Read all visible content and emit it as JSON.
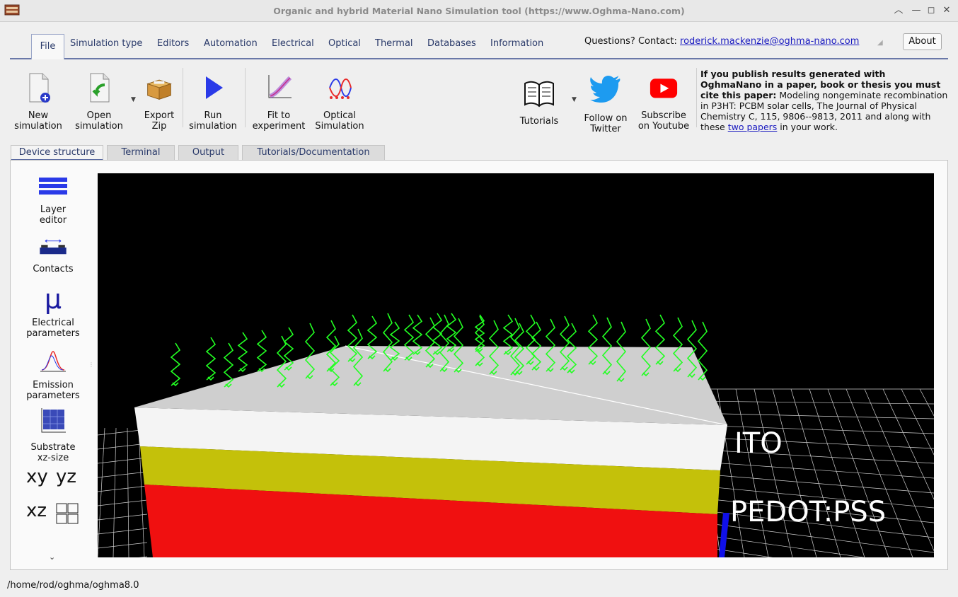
{
  "window": {
    "title": "Organic and hybrid Material Nano Simulation tool (https://www.Oghma-Nano.com)"
  },
  "menu": {
    "tabs": [
      {
        "label": "File"
      },
      {
        "label": "Simulation type"
      },
      {
        "label": "Editors"
      },
      {
        "label": "Automation"
      },
      {
        "label": "Electrical"
      },
      {
        "label": "Optical"
      },
      {
        "label": "Thermal"
      },
      {
        "label": "Databases"
      },
      {
        "label": "Information"
      }
    ]
  },
  "contact": {
    "prefix": "Questions? Contact: ",
    "email": "roderick.mackenzie@oghma-nano.com"
  },
  "about_label": "About",
  "toolbar": {
    "new_line1": "New",
    "new_line2": "simulation",
    "open_line1": "Open",
    "open_line2": "simulation",
    "export_line1": "Export",
    "export_line2": "Zip",
    "run_line1": "Run",
    "run_line2": "simulation",
    "fit_line1": "Fit to",
    "fit_line2": "experiment",
    "optical_line1": "Optical",
    "optical_line2": "Simulation",
    "tutorials": "Tutorials",
    "twitter_line1": "Follow on",
    "twitter_line2": "Twitter",
    "youtube_line1": "Subscribe",
    "youtube_line2": "on Youtube"
  },
  "cite": {
    "bold": "If you publish results generated with OghmaNano in a paper, book or thesis you must cite this paper:",
    "text": " Modeling nongeminate recombination in P3HT: PCBM solar cells, The Journal of Physical Chemistry C, 115, 9806--9813, 2011 and along with these ",
    "link": "two papers",
    "tail": " in your work."
  },
  "subtabs": [
    {
      "label": "Device structure"
    },
    {
      "label": "Terminal"
    },
    {
      "label": "Output"
    },
    {
      "label": "Tutorials/Documentation"
    }
  ],
  "sidebar": {
    "layer_line1": "Layer",
    "layer_line2": "editor",
    "contacts": "Contacts",
    "electrical_line1": "Electrical",
    "electrical_line2": "parameters",
    "emission_line1": "Emission",
    "emission_line2": "parameters",
    "substrate_line1": "Substrate",
    "substrate_line2": "xz-size",
    "mu_symbol": "μ",
    "view_xy": "xy",
    "view_yz": "yz",
    "view_xz": "xz"
  },
  "viewport": {
    "layer_label_1": "ITO",
    "layer_label_2": "PEDOT:PSS",
    "colors": {
      "top": "#f4f4f4",
      "yellow": "#c4c10a",
      "red": "#f01010",
      "photon": "#22ff22"
    }
  },
  "status": {
    "path": "/home/rod/oghma/oghma8.0"
  }
}
